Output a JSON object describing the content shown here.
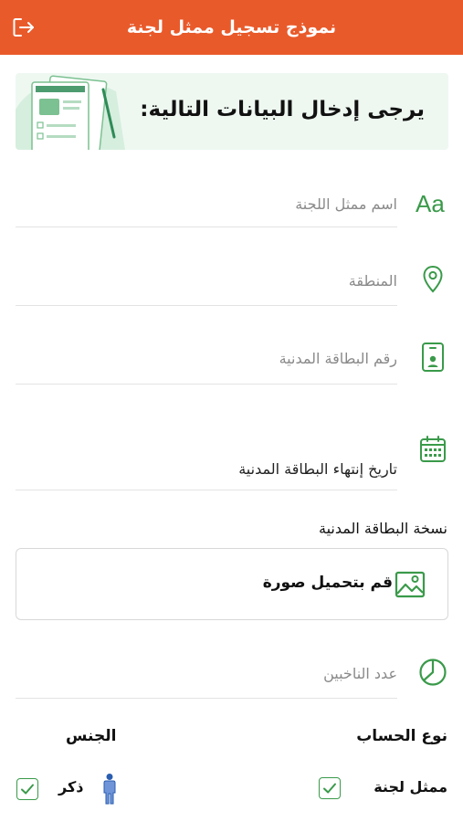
{
  "header": {
    "title": "نموذج تسجيل ممثل لجنة"
  },
  "banner": {
    "text": "يرجى إدخال البيانات التالية:"
  },
  "fields": {
    "representative_name": {
      "placeholder": "اسم ممثل اللجنة",
      "value": ""
    },
    "region": {
      "placeholder": "المنطقة",
      "value": ""
    },
    "civil_id": {
      "placeholder": "رقم البطاقة المدنية",
      "value": ""
    },
    "civil_id_expiry": {
      "label": "تاريخ إنتهاء البطاقة المدنية"
    },
    "voters_count": {
      "placeholder": "عدد الناخبين",
      "value": ""
    }
  },
  "civil_id_copy": {
    "label": "نسخة البطاقة المدنية",
    "upload_label": "قم بتحميل صورة"
  },
  "account_type": {
    "title": "نوع الحساب",
    "option_label": "ممثل لجنة",
    "checked": true
  },
  "gender": {
    "title": "الجنس",
    "option_label": "ذكر",
    "checked": true
  },
  "colors": {
    "header": "#e95a2a",
    "accent_green": "#3a9a4a",
    "banner_bg": "#eef8f1"
  },
  "icons": {
    "exit": "logout-icon",
    "name": "text-aa-icon",
    "region": "location-pin-icon",
    "civil_id": "id-card-icon",
    "date": "calendar-icon",
    "upload": "image-icon",
    "voters": "pie-chart-icon",
    "male": "male-person-icon"
  }
}
